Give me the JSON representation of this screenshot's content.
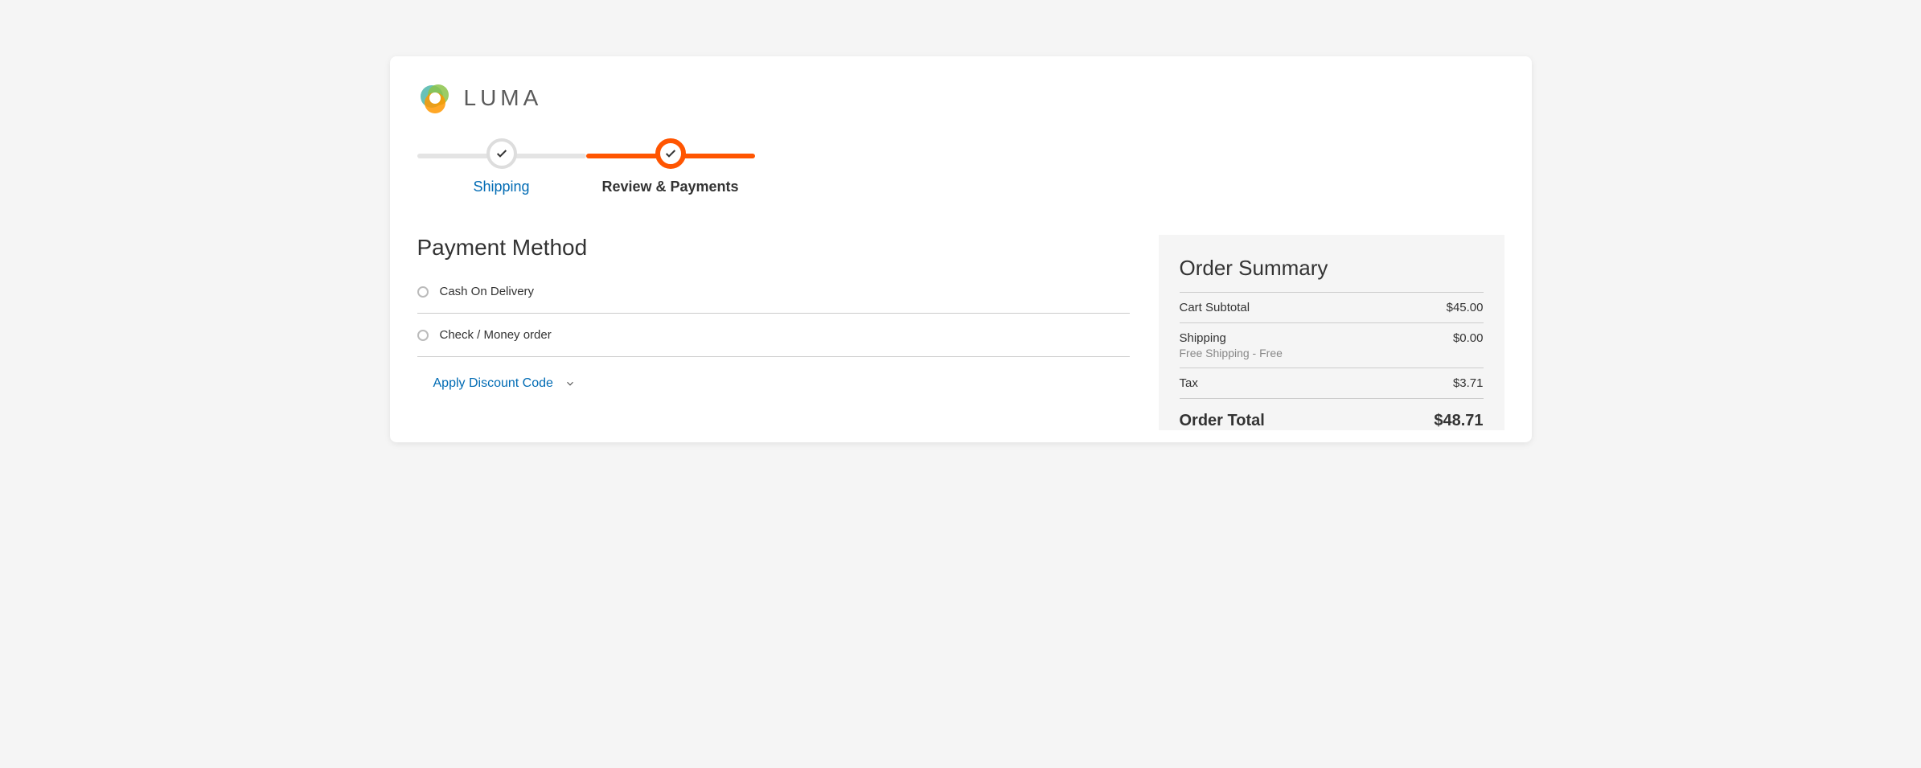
{
  "brand": "LUMA",
  "progress": {
    "step1": "Shipping",
    "step2": "Review & Payments"
  },
  "page_title": "Payment Method",
  "payment_options": {
    "opt1": "Cash On Delivery",
    "opt2": "Check / Money order"
  },
  "discount_link": "Apply Discount Code",
  "summary": {
    "title": "Order Summary",
    "subtotal_label": "Cart Subtotal",
    "subtotal_value": "$45.00",
    "shipping_label": "Shipping",
    "shipping_value": "$0.00",
    "shipping_sub": "Free Shipping - Free",
    "tax_label": "Tax",
    "tax_value": "$3.71",
    "total_label": "Order Total",
    "total_value": "$48.71"
  }
}
